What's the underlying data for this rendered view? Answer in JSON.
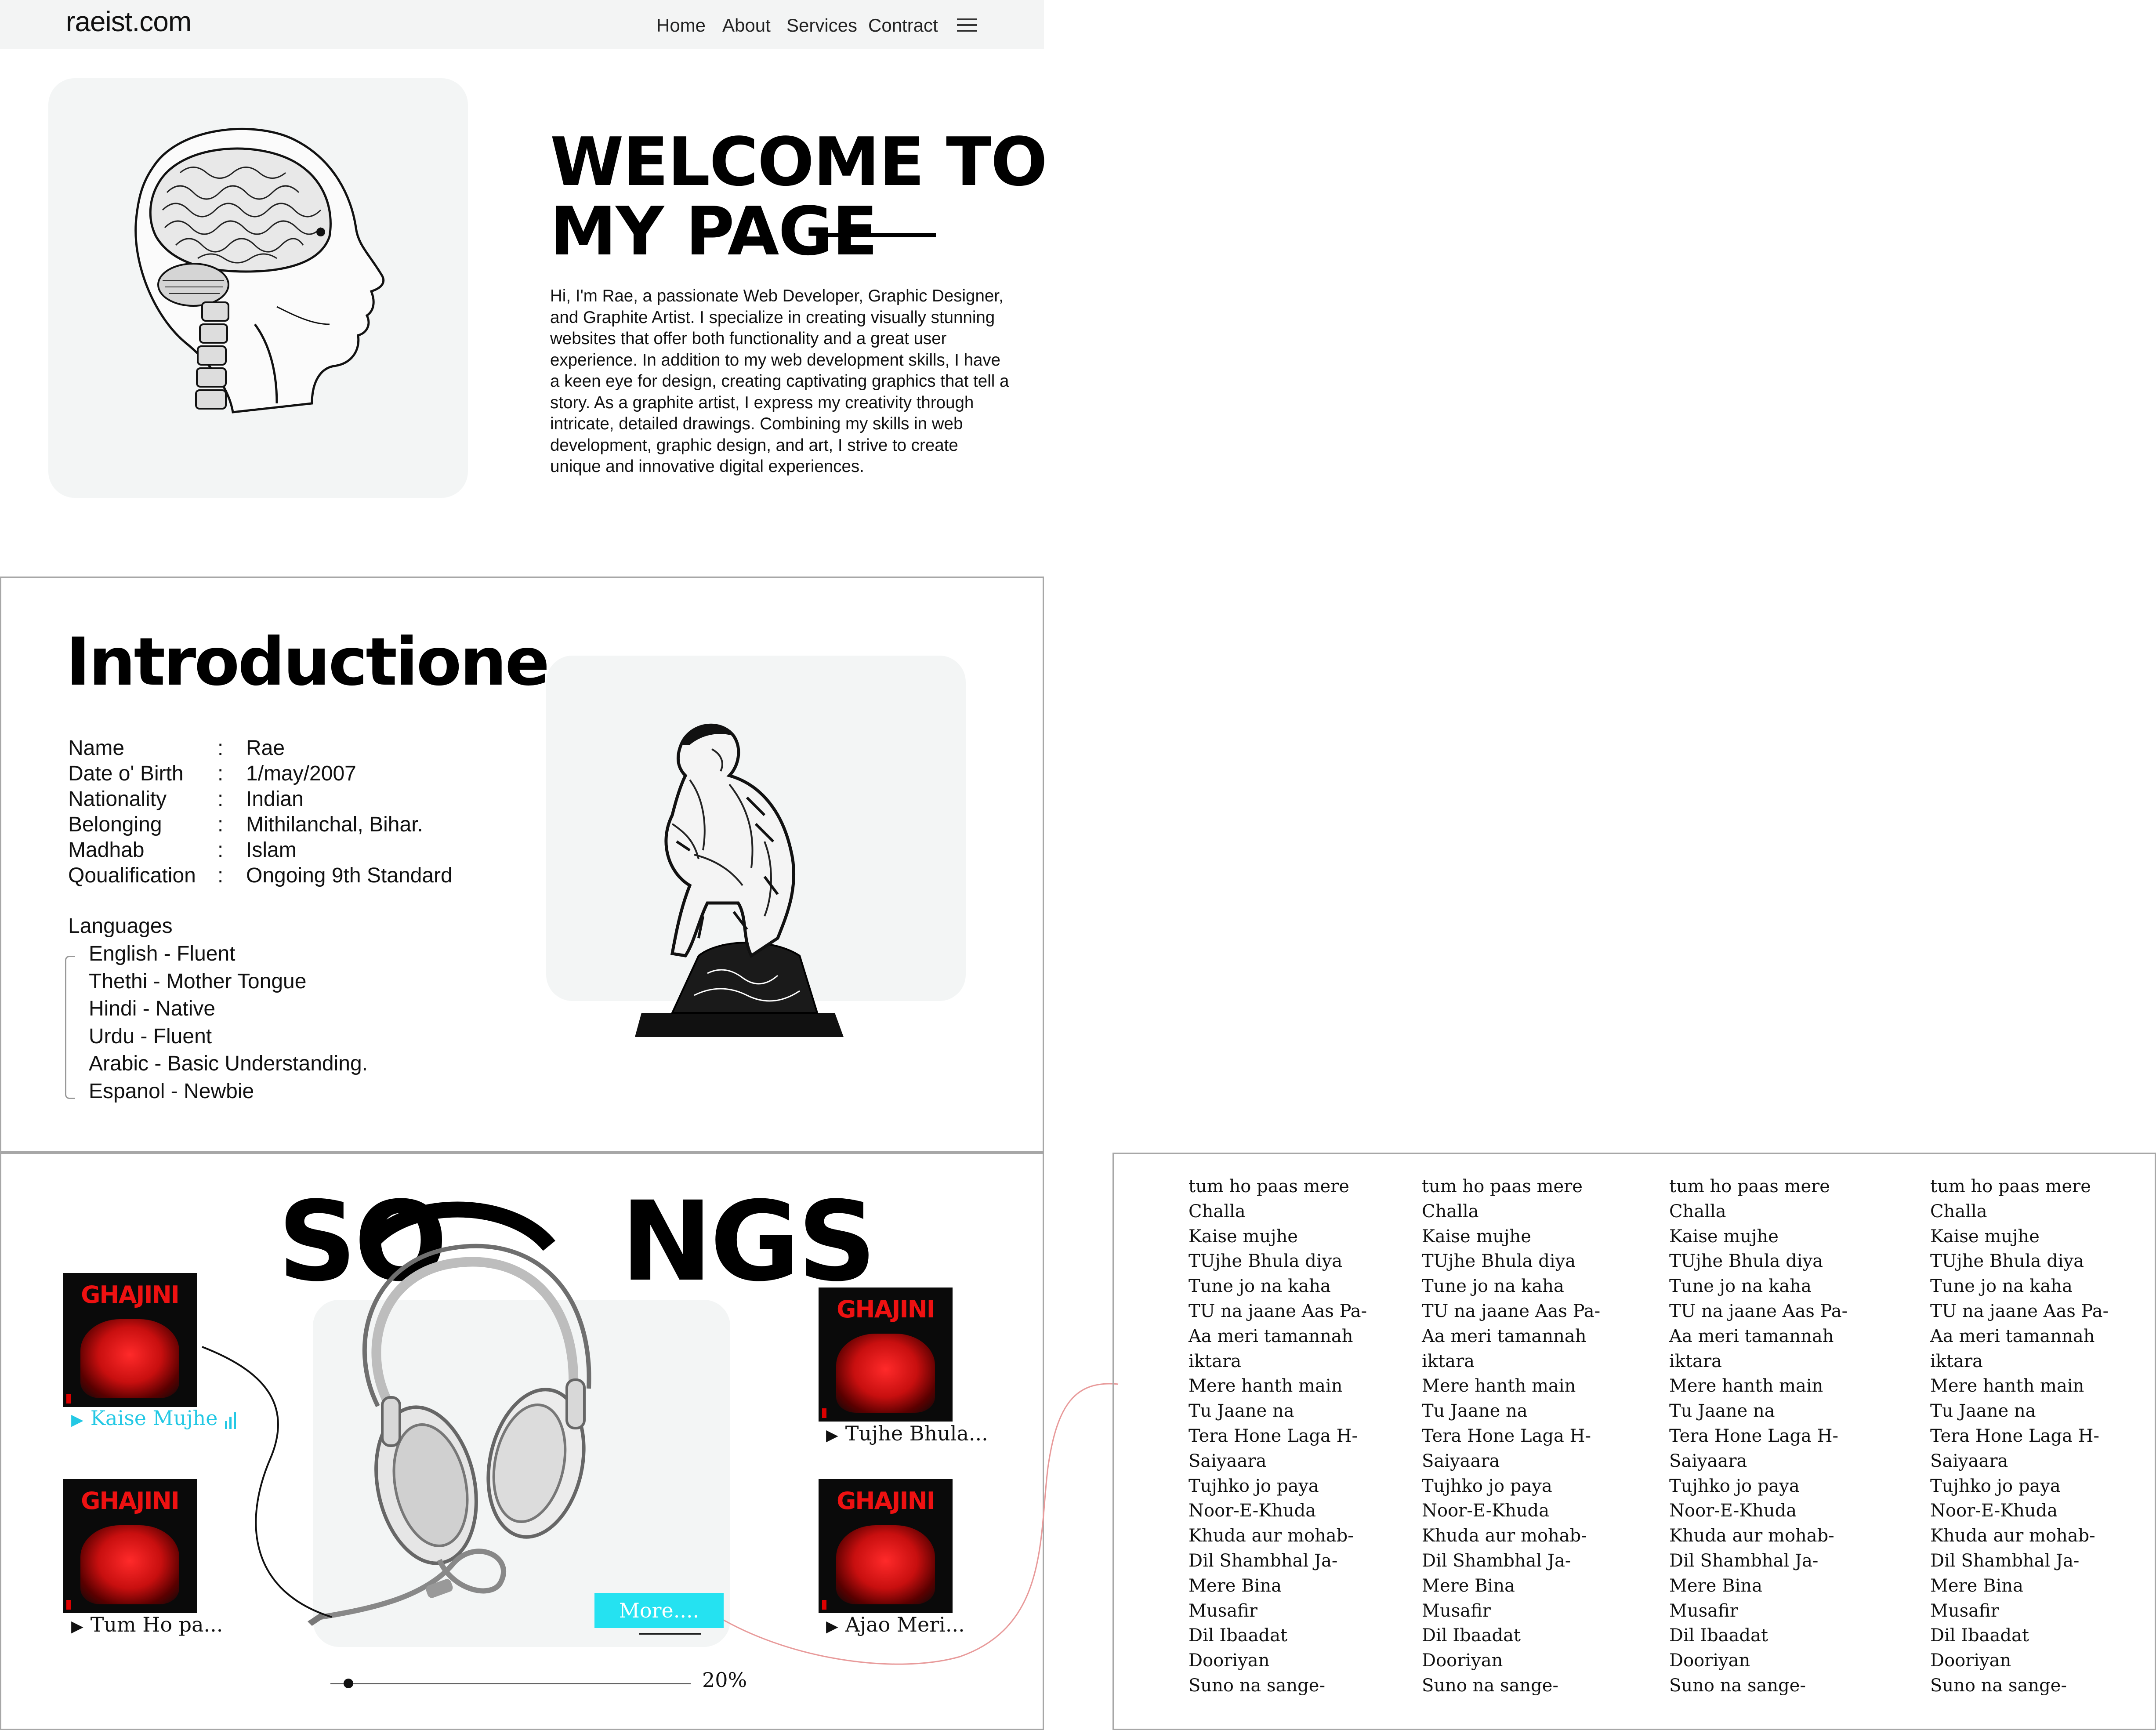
{
  "nav": {
    "logo": "raeist.com",
    "links": [
      "Home",
      "About",
      "Services",
      "Contract"
    ],
    "menu_icon": "hamburger-menu-icon"
  },
  "hero": {
    "title_line1": "WELCOME TO",
    "title_line2": "MY PAGE",
    "description": "Hi, I'm Rae, a passionate Web Developer, Graphic Designer, and Graphite Artist. I specialize in creating visually stunning websites that offer both functionality and a great user experience. In addition to my web development skills, I have a keen eye for design, creating captivating graphics that tell a story. As a graphite artist, I express my creativity through intricate, detailed drawings. Combining my skills in web development, graphic design, and art, I strive to create unique and innovative digital experiences.",
    "image_icon": "anatomical-head-illustration"
  },
  "intro": {
    "title": "Introductione",
    "info": [
      {
        "key": "Name",
        "value": "Rae"
      },
      {
        "key": "Date o' Birth",
        "value": "1/may/2007"
      },
      {
        "key": "Nationality",
        "value": "Indian"
      },
      {
        "key": "Belonging",
        "value": "Mithilanchal, Bihar."
      },
      {
        "key": "Madhab",
        "value": "Islam"
      },
      {
        "key": "Qoualification",
        "value": "Ongoing 9th Standard"
      }
    ],
    "separator": ":",
    "languages_label": "Languages",
    "languages": [
      "English - Fluent",
      "Thethi - Mother Tongue",
      "Hindi - Native",
      "Urdu - Fluent",
      "Arabic - Basic Understanding.",
      "Espanol - Newbie"
    ],
    "image_icon": "thinker-statue-illustration"
  },
  "songs": {
    "title_left": "SO",
    "title_right": "NGS",
    "album_title": "GHAJINI",
    "items": [
      {
        "label": "Kaise Mujhe",
        "active": true
      },
      {
        "label": "Tum Ho pa...",
        "active": false
      },
      {
        "label": "Tujhe Bhula...",
        "active": false
      },
      {
        "label": "Ajao Meri...",
        "active": false
      }
    ],
    "play_symbol": "▶",
    "more_label": "More....",
    "progress_text": "20%",
    "progress": 0.05,
    "accent_color": "#25e2f1",
    "active_color": "#23c8e4"
  },
  "lyrics": {
    "columns": [
      [
        "tum ho paas mere",
        "Challa",
        "Kaise mujhe",
        "TUjhe Bhula diya",
        "Tune jo na kaha",
        "TU na jaane Aas Pa-",
        "Aa meri tamannah",
        "iktara",
        "Mere hanth main",
        "Tu Jaane na",
        "Tera Hone Laga H-",
        "Saiyaara",
        "Tujhko jo paya",
        "Noor-E-Khuda",
        "Khuda aur mohab-",
        "Dil Shambhal Ja-",
        "Mere Bina",
        "Musafir",
        "Dil Ibaadat",
        "Dooriyan",
        "Suno na sange-"
      ],
      [
        "tum ho paas mere",
        "Challa",
        "Kaise mujhe",
        "TUjhe Bhula diya",
        "Tune jo na kaha",
        "TU na jaane Aas Pa-",
        "Aa meri tamannah",
        "iktara",
        "Mere hanth main",
        "Tu Jaane na",
        "Tera Hone Laga H-",
        "Saiyaara",
        "Tujhko jo paya",
        "Noor-E-Khuda",
        "Khuda aur mohab-",
        "Dil Shambhal Ja-",
        "Mere Bina",
        "Musafir",
        "Dil Ibaadat",
        "Dooriyan",
        "Suno na sange-"
      ],
      [
        "tum ho paas mere",
        "Challa",
        "Kaise mujhe",
        "TUjhe Bhula diya",
        "Tune jo na kaha",
        "TU na jaane Aas Pa-",
        "Aa meri tamannah",
        "iktara",
        "Mere hanth main",
        "Tu Jaane na",
        "Tera Hone Laga H-",
        "Saiyaara",
        "Tujhko jo paya",
        "Noor-E-Khuda",
        "Khuda aur mohab-",
        "Dil Shambhal Ja-",
        "Mere Bina",
        "Musafir",
        "Dil Ibaadat",
        "Dooriyan",
        "Suno na sange-"
      ],
      [
        "tum ho paas mere",
        "Challa",
        "Kaise mujhe",
        "TUjhe Bhula diya",
        "Tune jo na kaha",
        "TU na jaane Aas Pa-",
        "Aa meri tamannah",
        "iktara",
        "Mere hanth main",
        "Tu Jaane na",
        "Tera Hone Laga H-",
        "Saiyaara",
        "Tujhko jo paya",
        "Noor-E-Khuda",
        "Khuda aur mohab-",
        "Dil Shambhal Ja-",
        "Mere Bina",
        "Musafir",
        "Dil Ibaadat",
        "Dooriyan",
        "Suno na sange-"
      ]
    ]
  }
}
